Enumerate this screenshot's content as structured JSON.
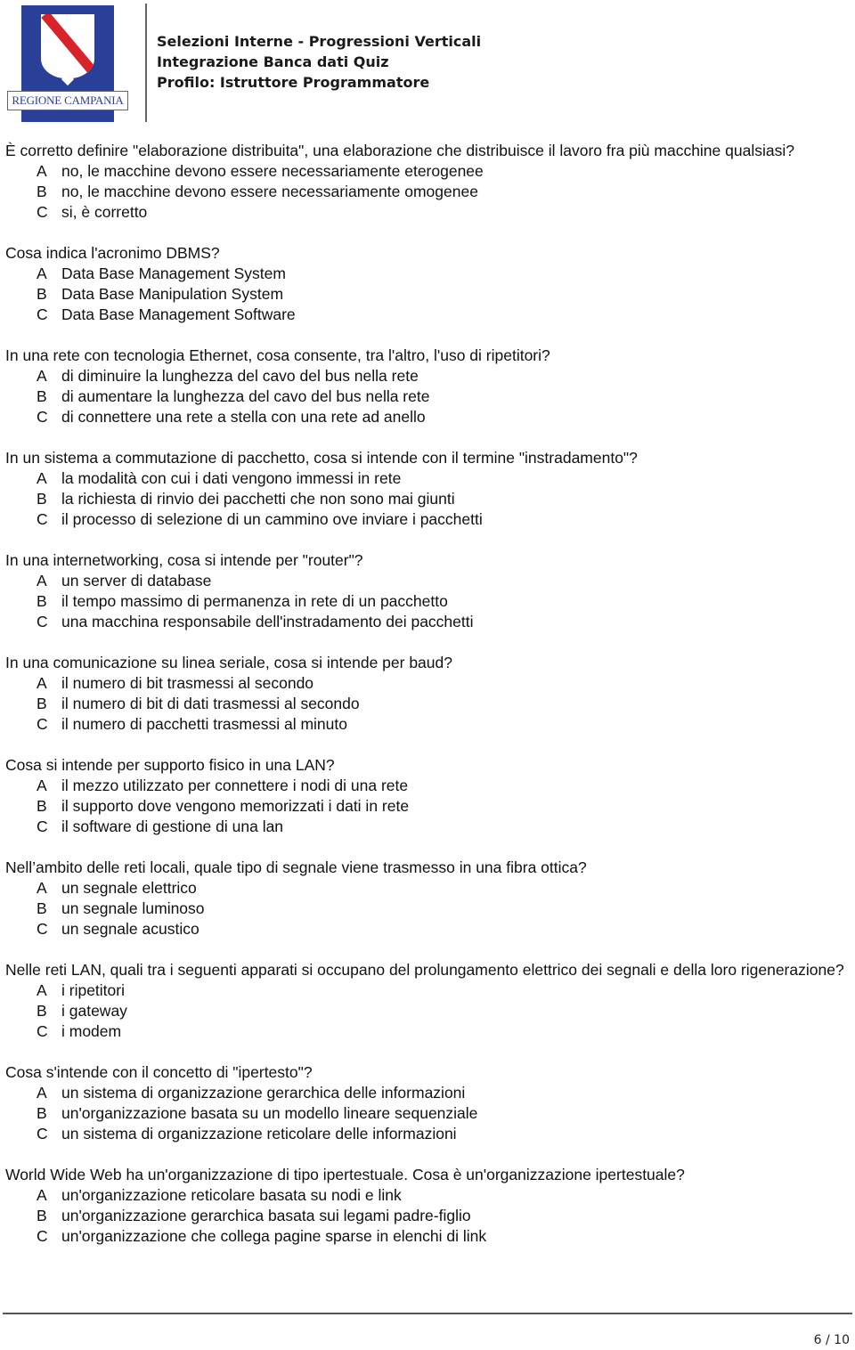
{
  "header": {
    "logo_text": "REGIONE CAMPANIA",
    "title_lines": [
      "Selezioni Interne - Progressioni Verticali",
      "Integrazione Banca dati Quiz",
      "Profilo: Istruttore Programmatore"
    ],
    "colors": {
      "logo_blue": "#2a3f97",
      "logo_red_band": "#d8232a"
    }
  },
  "questions": [
    {
      "text": "È corretto definire \"elaborazione distribuita\", una  elaborazione che distribuisce il lavoro fra più macchine qualsiasi?",
      "options": [
        {
          "letter": "A",
          "text": "no, le macchine devono essere necessariamente eterogenee"
        },
        {
          "letter": "B",
          "text": "no, le macchine devono essere necessariamente omogenee"
        },
        {
          "letter": "C",
          "text": "si, è corretto"
        }
      ]
    },
    {
      "text": "Cosa indica l'acronimo DBMS?",
      "options": [
        {
          "letter": "A",
          "text": "Data Base Management System"
        },
        {
          "letter": "B",
          "text": "Data Base Manipulation System"
        },
        {
          "letter": "C",
          "text": "Data Base Management Software"
        }
      ]
    },
    {
      "text": "In una rete con tecnologia Ethernet, cosa consente, tra   l'altro, l'uso di ripetitori?",
      "options": [
        {
          "letter": "A",
          "text": "di diminuire la lunghezza del cavo del bus nella rete"
        },
        {
          "letter": "B",
          "text": "di aumentare la lunghezza del cavo del bus nella rete"
        },
        {
          "letter": "C",
          "text": "di connettere una rete a stella con una rete ad anello"
        }
      ]
    },
    {
      "text": "In un sistema a commutazione di pacchetto, cosa si intende con il termine \"instradamento\"?",
      "options": [
        {
          "letter": "A",
          "text": "la modalità con cui i dati vengono immessi in rete"
        },
        {
          "letter": "B",
          "text": "la richiesta di rinvio dei pacchetti che non sono mai giunti"
        },
        {
          "letter": "C",
          "text": "il processo di selezione di un cammino ove inviare i pacchetti"
        }
      ]
    },
    {
      "text": "In una internetworking, cosa si intende per \"router\"?",
      "options": [
        {
          "letter": "A",
          "text": "un server di database"
        },
        {
          "letter": "B",
          "text": "il tempo massimo di permanenza in rete di un pacchetto"
        },
        {
          "letter": "C",
          "text": "una macchina responsabile dell'instradamento dei pacchetti"
        }
      ]
    },
    {
      "text": "In una comunicazione su linea seriale, cosa si intende per baud?",
      "options": [
        {
          "letter": "A",
          "text": "il numero di bit trasmessi al secondo"
        },
        {
          "letter": "B",
          "text": "il numero di bit di dati trasmessi al secondo"
        },
        {
          "letter": "C",
          "text": "il numero di pacchetti trasmessi al minuto"
        }
      ]
    },
    {
      "text": "Cosa si intende per supporto fisico in una LAN?",
      "options": [
        {
          "letter": "A",
          "text": "il mezzo utilizzato per connettere i nodi di una rete"
        },
        {
          "letter": "B",
          "text": "il supporto dove vengono memorizzati i dati in rete"
        },
        {
          "letter": "C",
          "text": "il software di gestione di una lan"
        }
      ]
    },
    {
      "text": "Nell’ambito delle reti locali, quale tipo di segnale viene trasmesso in una fibra ottica?",
      "options": [
        {
          "letter": "A",
          "text": "un segnale elettrico"
        },
        {
          "letter": "B",
          "text": "un segnale luminoso"
        },
        {
          "letter": "C",
          "text": "un segnale acustico"
        }
      ]
    },
    {
      "text": "Nelle reti LAN, quali tra i seguenti apparati si occupano del prolungamento elettrico dei segnali e della loro rigenerazione?",
      "options": [
        {
          "letter": "A",
          "text": "i ripetitori"
        },
        {
          "letter": "B",
          "text": "i gateway"
        },
        {
          "letter": "C",
          "text": "i modem"
        }
      ]
    },
    {
      "text": "Cosa s'intende con il concetto di \"ipertesto\"?",
      "options": [
        {
          "letter": "A",
          "text": "un sistema di organizzazione gerarchica delle informazioni"
        },
        {
          "letter": "B",
          "text": "un'organizzazione basata su un modello lineare sequenziale"
        },
        {
          "letter": "C",
          "text": "un sistema di organizzazione reticolare delle informazioni"
        }
      ]
    },
    {
      "text": "World Wide Web ha un'organizzazione di tipo ipertestuale. Cosa è un'organizzazione ipertestuale?",
      "options": [
        {
          "letter": "A",
          "text": "un'organizzazione reticolare basata su nodi e link"
        },
        {
          "letter": "B",
          "text": "un'organizzazione gerarchica basata sui legami padre-figlio"
        },
        {
          "letter": "C",
          "text": "un'organizzazione che collega pagine sparse in elenchi di link"
        }
      ]
    }
  ],
  "footer": {
    "page_label": "6 / 10"
  }
}
